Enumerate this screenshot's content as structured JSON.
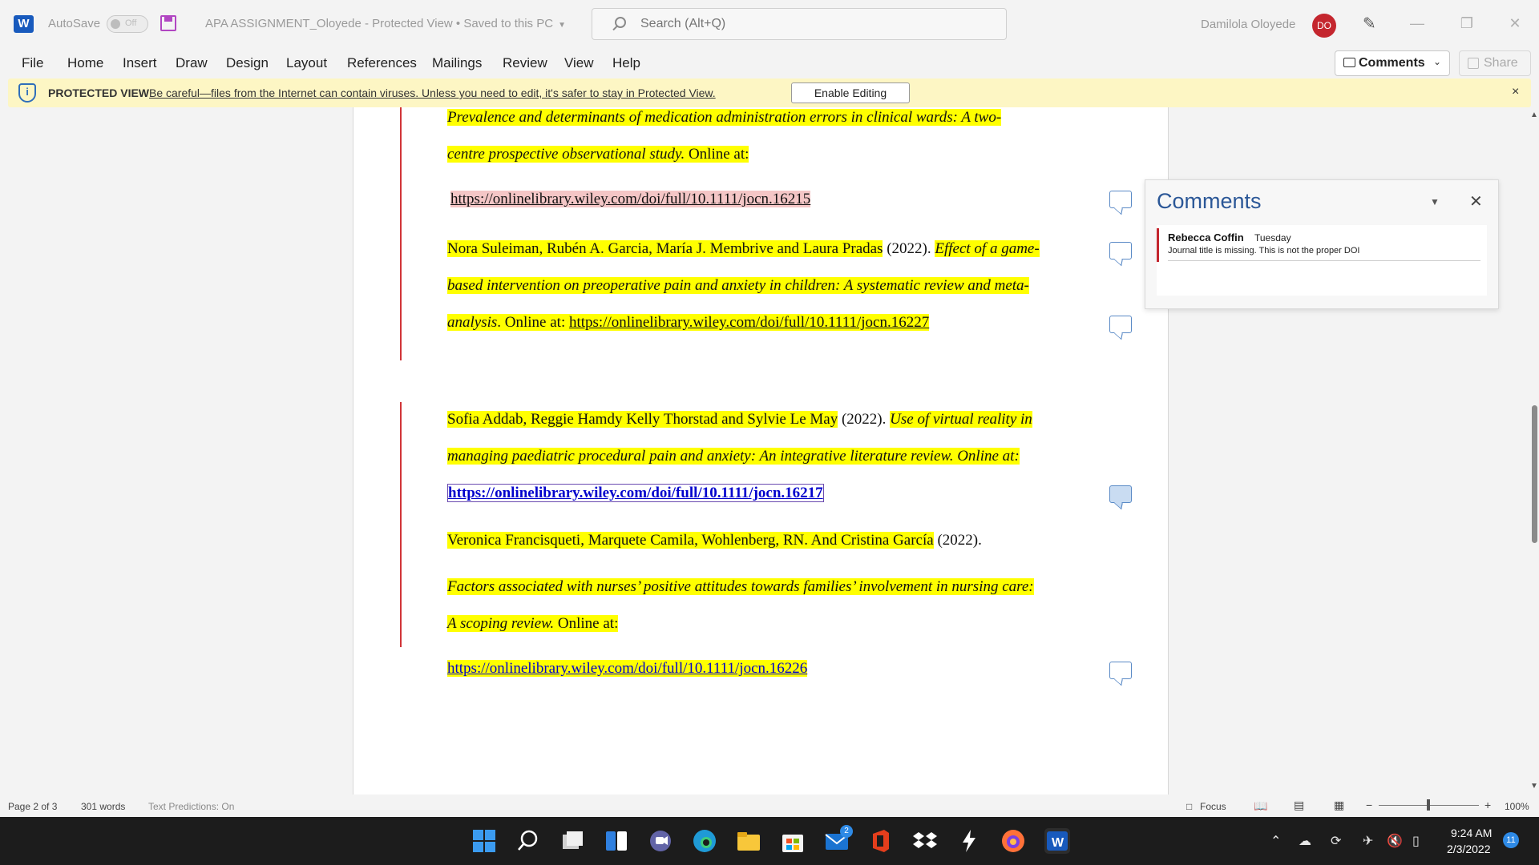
{
  "titlebar": {
    "autosave_label": "AutoSave",
    "autosave_state": "Off",
    "doc_title": "APA ASSIGNMENT_Oloyede  -  Protected View • Saved to this PC",
    "search_placeholder": "Search (Alt+Q)",
    "user_name": "Damilola  Oloyede",
    "user_initials": "DO"
  },
  "menu": {
    "items": [
      "File",
      "Home",
      "Insert",
      "Draw",
      "Design",
      "Layout",
      "References",
      "Mailings",
      "Review",
      "View",
      "Help"
    ],
    "comments_label": "Comments",
    "share_label": "Share"
  },
  "protected_view": {
    "title": "PROTECTED VIEW",
    "message": "Be careful—files from the Internet can contain viruses. Unless you need to edit, it's safer to stay in Protected View.",
    "enable_label": "Enable Editing",
    "close": "×"
  },
  "document": {
    "l1": "Prevalence and determinants of medication administration errors in clinical wards: A two-",
    "l2a": "centre prospective observational study.",
    "l2b": " Online at:",
    "l3": "https://onlinelibrary.wiley.com/doi/full/10.1111/jocn.16215",
    "l4a": "Nora Suleiman, Rubén A. Garcia, María J. Membrive and Laura Pradas",
    "l4b": " (2022). ",
    "l4c": "Effect of a game-",
    "l5": "based intervention on preoperative pain and anxiety in children: A systematic review and meta-",
    "l6a": "analysis",
    "l6b": ". Online at: ",
    "l6c": "https://onlinelibrary.wiley.com/doi/full/10.1111/jocn.16227",
    "l7a": "Sofia Addab, Reggie Hamdy Kelly Thorstad and Sylvie Le May",
    "l7b": " (2022). ",
    "l7c": "Use of virtual reality in",
    "l8": "managing paediatric procedural pain and anxiety: An integrative literature review. Online at:",
    "l9": "https://onlinelibrary.wiley.com/doi/full/10.1111/jocn.16217",
    "l10a": "Veronica Francisqueti, Marquete Camila, Wohlenberg, RN.  And Cristina García",
    "l10b": " (2022).",
    "l11": "Factors associated with nurses’ positive attitudes towards families’ involvement in nursing care:",
    "l12a": "A scoping review.",
    "l12b": " Online at:",
    "l13": "https://onlinelibrary.wiley.com/doi/full/10.1111/jocn.16226"
  },
  "comments_pane": {
    "title": "Comments",
    "author": "Rebecca Coffin",
    "date": "Tuesday",
    "text": "Journal title is missing. This is not the proper DOI"
  },
  "status": {
    "page": "Page 2 of 3",
    "words": "301 words",
    "predictions": "Text Predictions: On",
    "focus": "Focus",
    "zoom": "100%"
  },
  "taskbar": {
    "time": "9:24 AM",
    "date": "2/3/2022",
    "notifications": "11",
    "mail_badge": "2"
  },
  "colors": {
    "highlight": "#ffff00",
    "revision_bar": "#d13438",
    "accent": "#2b5797",
    "word_blue": "#185abd"
  }
}
